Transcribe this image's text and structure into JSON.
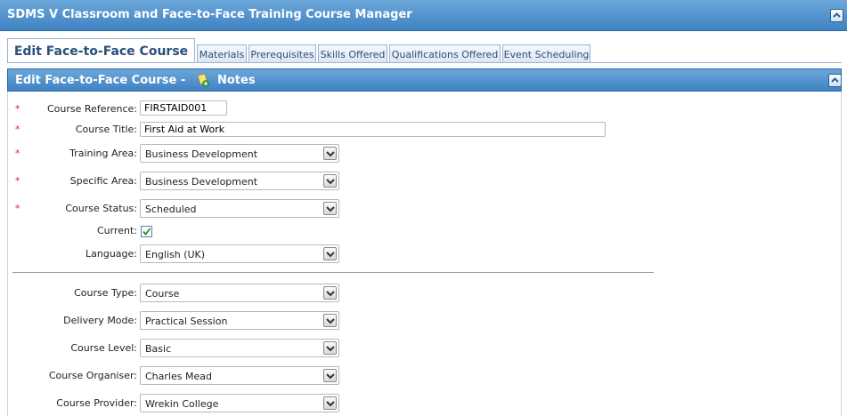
{
  "app": {
    "title": "SDMS V Classroom and Face-to-Face Training Course Manager"
  },
  "tabs": [
    {
      "label": "Edit Face-to-Face Course"
    },
    {
      "label": "Materials"
    },
    {
      "label": "Prerequisites"
    },
    {
      "label": "Skills Offered"
    },
    {
      "label": "Qualifications Offered"
    },
    {
      "label": "Event Scheduling"
    }
  ],
  "panel": {
    "title": "Edit Face-to-Face Course -",
    "notes_label": "Notes"
  },
  "form": {
    "required_marker": "*",
    "course_reference": {
      "label": "Course Reference:",
      "value": "FIRSTAID001"
    },
    "course_title": {
      "label": "Course Title:",
      "value": "First Aid at Work"
    },
    "training_area": {
      "label": "Training Area:",
      "value": "Business Development"
    },
    "specific_area": {
      "label": "Specific Area:",
      "value": "Business Development"
    },
    "course_status": {
      "label": "Course Status:",
      "value": "Scheduled"
    },
    "current": {
      "label": "Current:",
      "checked": true
    },
    "language": {
      "label": "Language:",
      "value": "English (UK)"
    },
    "course_type": {
      "label": "Course Type:",
      "value": "Course"
    },
    "delivery_mode": {
      "label": "Delivery Mode:",
      "value": "Practical Session"
    },
    "course_level": {
      "label": "Course Level:",
      "value": "Basic"
    },
    "course_organiser": {
      "label": "Course Organiser:",
      "value": "Charles Mead"
    },
    "course_provider": {
      "label": "Course Provider:",
      "value": "Wrekin College"
    }
  }
}
